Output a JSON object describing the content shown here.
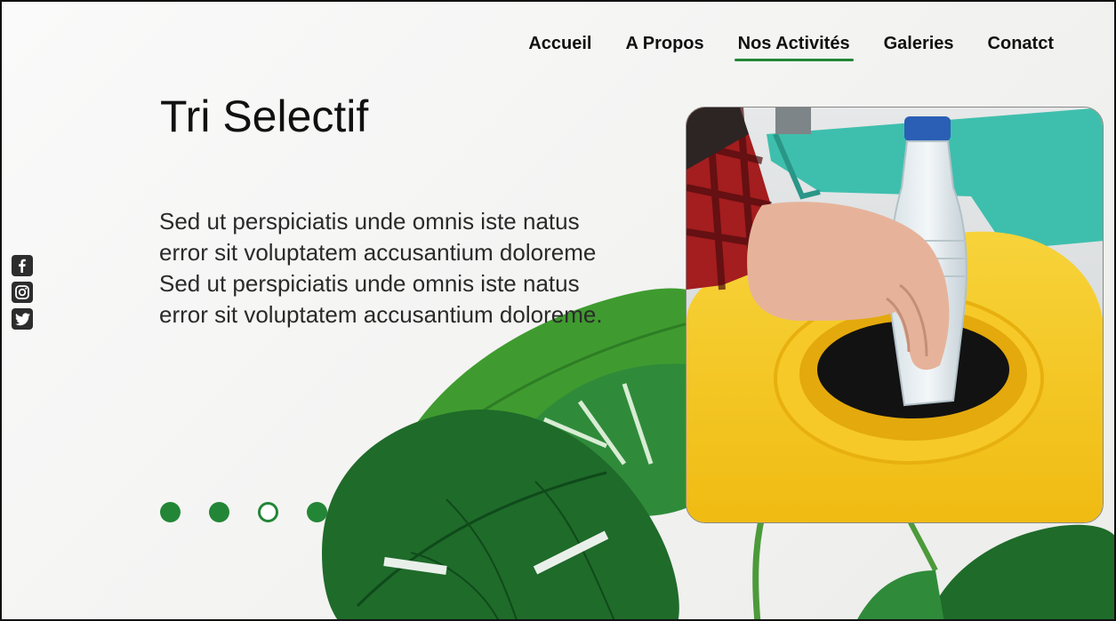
{
  "nav": {
    "items": [
      {
        "label": "Accueil",
        "active": false
      },
      {
        "label": "A Propos",
        "active": false
      },
      {
        "label": "Nos Activités",
        "active": true
      },
      {
        "label": "Galeries",
        "active": false
      },
      {
        "label": "Conatct",
        "active": false
      }
    ]
  },
  "hero": {
    "title": "Tri Selectif",
    "paragraphs": [
      "Sed ut perspiciatis unde omnis iste natus error sit voluptatem accusantium doloreme",
      "Sed ut perspiciatis unde omnis iste natus error sit voluptatem accusantium doloreme."
    ]
  },
  "social": {
    "icons": [
      "facebook-icon",
      "instagram-icon",
      "twitter-icon"
    ]
  },
  "pager": {
    "count": 4,
    "active_index": 2
  },
  "colors": {
    "accent": "#238636",
    "bin_yellow": "#f3c81c",
    "text": "#111111"
  }
}
